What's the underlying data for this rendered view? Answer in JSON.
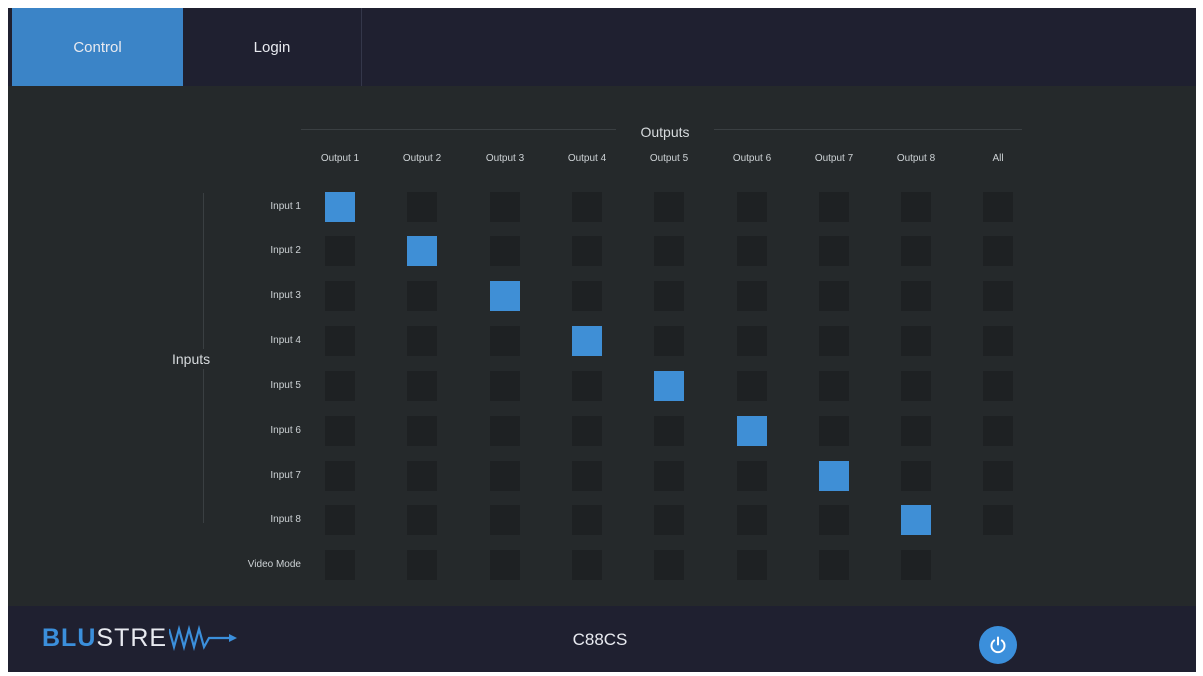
{
  "tabs": [
    {
      "label": "Control",
      "active": true
    },
    {
      "label": "Login",
      "active": false
    }
  ],
  "matrix": {
    "outputs_title": "Outputs",
    "inputs_title": "Inputs",
    "columns": [
      "Output 1",
      "Output 2",
      "Output 3",
      "Output 4",
      "Output 5",
      "Output 6",
      "Output 7",
      "Output 8",
      "All"
    ],
    "rows": [
      "Input 1",
      "Input 2",
      "Input 3",
      "Input 4",
      "Input 5",
      "Input 6",
      "Input 7",
      "Input 8",
      "Video Mode"
    ],
    "active_routes": [
      [
        0,
        0
      ],
      [
        1,
        1
      ],
      [
        2,
        2
      ],
      [
        3,
        3
      ],
      [
        4,
        4
      ],
      [
        5,
        5
      ],
      [
        6,
        6
      ],
      [
        7,
        7
      ]
    ],
    "active_color": "#3f8fd6",
    "inactive_color": "#1e2123"
  },
  "footer": {
    "logo_blu": "BLU",
    "logo_stream": "STRE",
    "model": "C88CS",
    "power_icon": "power-icon"
  },
  "colors": {
    "accent": "#3b84c7",
    "bar_background": "#1f2030",
    "panel_background": "#25292b"
  }
}
